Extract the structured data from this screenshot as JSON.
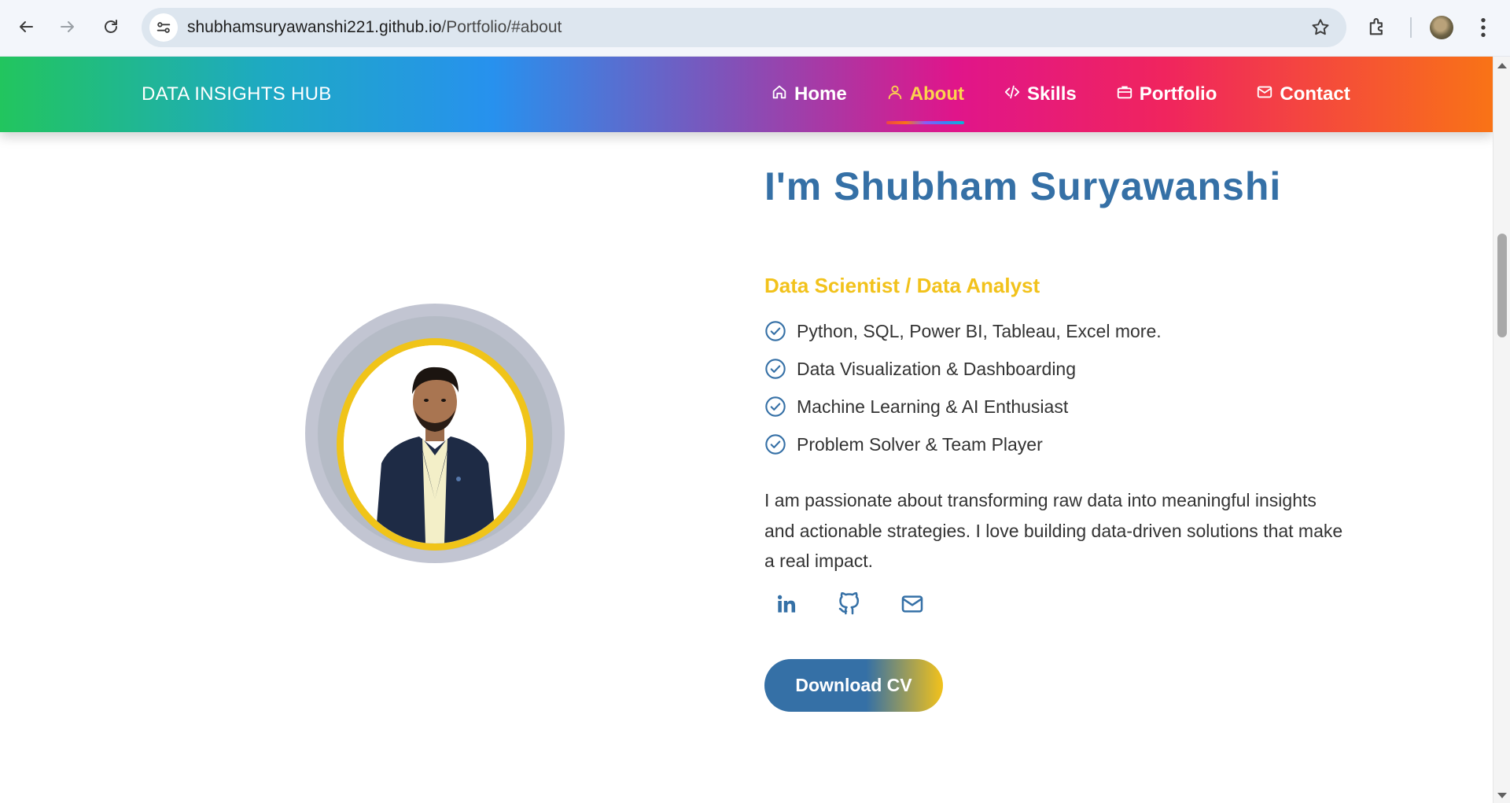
{
  "browser": {
    "url_host": "shubhamsuryawanshi221.github.io",
    "url_path": "/Portfolio/#about",
    "icons": [
      "back-arrow-icon",
      "forward-arrow-icon",
      "reload-icon",
      "site-info-icon",
      "bookmark-star-icon",
      "extensions-icon",
      "profile-avatar",
      "more-menu-icon"
    ]
  },
  "header": {
    "brand": "DATA INSIGHTS HUB",
    "nav": [
      {
        "label": "Home",
        "icon": "home-icon",
        "active": false
      },
      {
        "label": "About",
        "icon": "user-icon",
        "active": true
      },
      {
        "label": "Skills",
        "icon": "code-icon",
        "active": false
      },
      {
        "label": "Portfolio",
        "icon": "briefcase-icon",
        "active": false
      },
      {
        "label": "Contact",
        "icon": "mail-icon",
        "active": false
      }
    ],
    "active_color": "#fcd34d"
  },
  "about": {
    "title": "I'm Shubham Suryawanshi",
    "subtitle": "Data Scientist / Data Analyst",
    "skills": [
      "Python, SQL, Power BI, Tableau, Excel more.",
      "Data Visualization & Dashboarding",
      "Machine Learning & AI Enthusiast",
      "Problem Solver & Team Player"
    ],
    "bio": "I am passionate about transforming raw data into meaningful insights and actionable strategies. I love building data-driven solutions that make a real impact.",
    "socials": [
      "linkedin-icon",
      "github-icon",
      "email-icon"
    ],
    "cv_button": "Download CV",
    "colors": {
      "primary": "#3570a6",
      "accent": "#f2c21b"
    }
  }
}
